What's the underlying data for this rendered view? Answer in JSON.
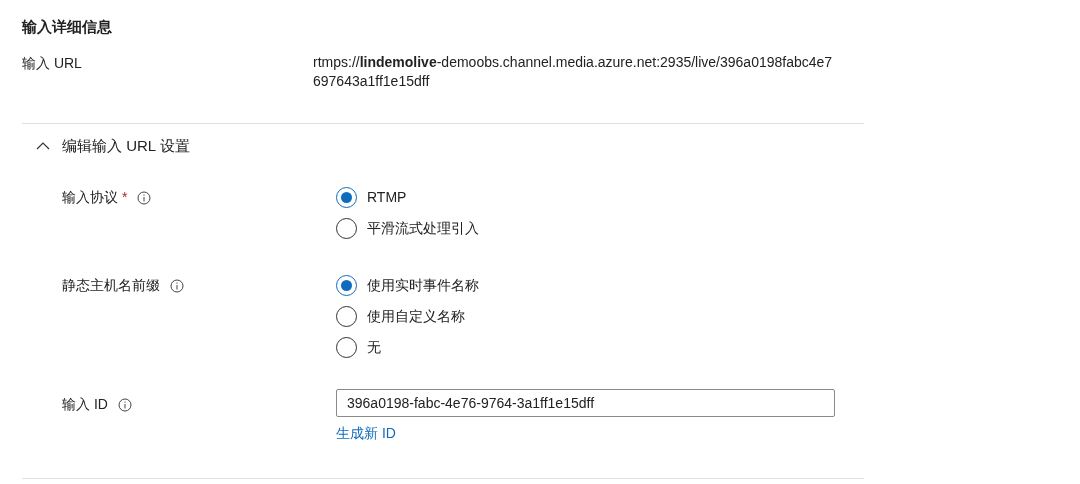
{
  "section_title": "输入详细信息",
  "input_url": {
    "label": "输入 URL",
    "value": "rtmps://**lindemolive**-demoobs.channel.media.azure.net:2935/live/396a0198fabc4e7697643a1ff1e15dff"
  },
  "expander": {
    "label": "编辑输入 URL 设置",
    "expanded": true
  },
  "fields": [
    {
      "kind": "radio",
      "label": "输入协议",
      "required_mark": "*",
      "options": [
        {
          "label": "RTMP",
          "selected": true
        },
        {
          "label": "平滑流式处理引入",
          "selected": false
        }
      ]
    },
    {
      "kind": "radio",
      "label": "静态主机名前缀",
      "options": [
        {
          "label": "使用实时事件名称",
          "selected": true
        },
        {
          "label": "使用自定义名称",
          "selected": false
        },
        {
          "label": "无",
          "selected": false
        }
      ]
    },
    {
      "kind": "text",
      "label": "输入 ID",
      "value": "396a0198-fabc-4e76-9764-3a1ff1e15dff",
      "link": "生成新 ID"
    }
  ]
}
